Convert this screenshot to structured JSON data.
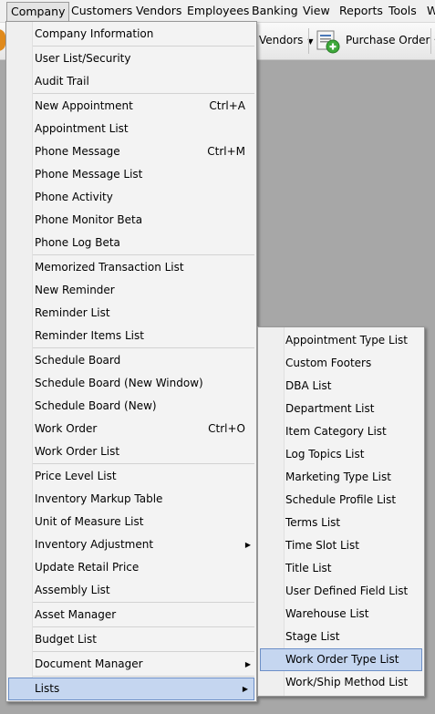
{
  "menubar": {
    "items": [
      {
        "label": "Company",
        "open": true
      },
      {
        "label": "Customers"
      },
      {
        "label": "Vendors"
      },
      {
        "label": "Employees"
      },
      {
        "label": "Banking"
      },
      {
        "label": "View"
      },
      {
        "label": "Reports"
      },
      {
        "label": "Tools"
      },
      {
        "label": "W"
      }
    ]
  },
  "toolbar": {
    "vendors_label": "Vendors",
    "purchase_order_label": "Purchase Order",
    "colors": {
      "icon_green": "#3da83a",
      "icon_blue": "#4a78b8",
      "accent": "#e08a1c"
    }
  },
  "company_menu": {
    "groups": [
      [
        {
          "label": "Company Information"
        }
      ],
      [
        {
          "label": "User List/Security"
        },
        {
          "label": "Audit Trail"
        }
      ],
      [
        {
          "label": "New Appointment",
          "shortcut": "Ctrl+A"
        },
        {
          "label": "Appointment List"
        },
        {
          "label": "Phone Message",
          "shortcut": "Ctrl+M"
        },
        {
          "label": "Phone Message List"
        },
        {
          "label": "Phone Activity"
        },
        {
          "label": "Phone Monitor Beta"
        },
        {
          "label": "Phone Log Beta"
        }
      ],
      [
        {
          "label": "Memorized Transaction List"
        },
        {
          "label": "New Reminder"
        },
        {
          "label": "Reminder List"
        },
        {
          "label": "Reminder Items List"
        }
      ],
      [
        {
          "label": "Schedule Board"
        },
        {
          "label": "Schedule Board (New Window)"
        },
        {
          "label": "Schedule Board (New)"
        },
        {
          "label": "Work Order",
          "shortcut": "Ctrl+O"
        },
        {
          "label": "Work Order List"
        }
      ],
      [
        {
          "label": "Price Level List"
        },
        {
          "label": "Inventory Markup Table"
        },
        {
          "label": "Unit of Measure List"
        },
        {
          "label": "Inventory Adjustment",
          "submenu": true
        },
        {
          "label": "Update Retail Price"
        },
        {
          "label": "Assembly List"
        }
      ],
      [
        {
          "label": "Asset Manager"
        }
      ],
      [
        {
          "label": "Budget List"
        }
      ],
      [
        {
          "label": "Document Manager",
          "submenu": true
        }
      ],
      [
        {
          "label": "Lists",
          "submenu": true,
          "highlighted": true
        }
      ]
    ]
  },
  "lists_menu": {
    "items": [
      {
        "label": "Appointment Type List"
      },
      {
        "label": "Custom Footers"
      },
      {
        "label": "DBA List"
      },
      {
        "label": "Department List"
      },
      {
        "label": "Item Category List"
      },
      {
        "label": "Log Topics List"
      },
      {
        "label": "Marketing Type List"
      },
      {
        "label": "Schedule Profile List"
      },
      {
        "label": "Terms List"
      },
      {
        "label": "Time Slot List"
      },
      {
        "label": "Title List"
      },
      {
        "label": "User Defined Field List"
      },
      {
        "label": "Warehouse List"
      },
      {
        "label": "Stage List"
      },
      {
        "label": "Work Order Type List",
        "highlighted": true
      },
      {
        "label": "Work/Ship Method List"
      }
    ]
  }
}
